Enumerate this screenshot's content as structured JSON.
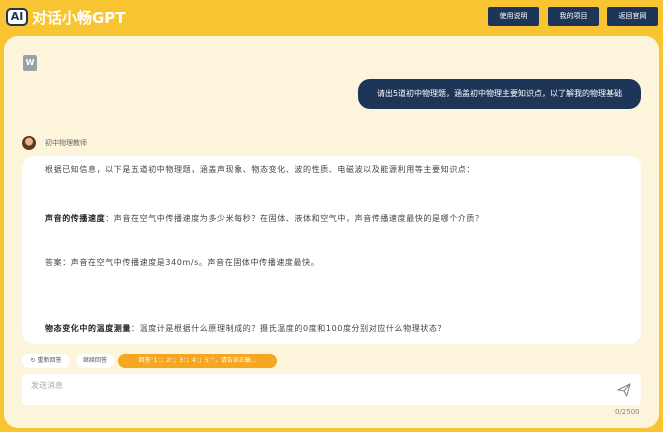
{
  "app": {
    "logo_text": "AI",
    "title": "对话小畅GPT"
  },
  "header": {
    "buttons": [
      "使用说明",
      "我的项目",
      "返回官网"
    ]
  },
  "attachment": {
    "icon": "word-file-icon",
    "label": "W"
  },
  "user_message": "请出5道初中物理题，涵盖初中物理主要知识点，以了解我的物理基础",
  "bot": {
    "name": "初中物理教师",
    "avatar_icon": "teacher-avatar"
  },
  "answer": {
    "intro": "根据已知信息，以下是五道初中物理题，涵盖声现象、物态变化、波的性质、电磁波以及能源利用等主要知识点：",
    "q1_title": "声音的传播速度",
    "q1_text": "：声音在空气中传播速度为多少米每秒？在固体、液体和空气中，声音传播速度最快的是哪个介质？",
    "a1": "答案：声音在空气中传播速度是340m/s。声音在固体中传播速度最快。",
    "q2_title": "物态变化中的温度测量",
    "q2_text": "：温度计是根据什么原理制成的？摄氏温度的0度和100度分别对应什么物理状态？"
  },
  "actions": {
    "regenerate": "重新回答",
    "regenerate_icon": "refresh-icon",
    "continue": "继续回答",
    "suggestion": "回答“1：；2：；3：；4：；5：”，请告诉正确..."
  },
  "input": {
    "placeholder": "发送消息",
    "counter": "0/2500",
    "send_icon": "paper-plane-icon"
  },
  "colors": {
    "background": "#f9c432",
    "panel": "#fdf4dc",
    "primary": "#1d3557",
    "accent": "#f5a623"
  }
}
